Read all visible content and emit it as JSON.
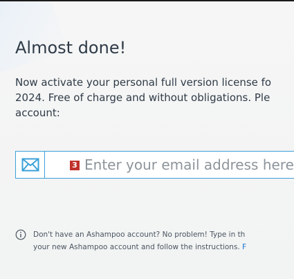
{
  "dialog": {
    "title": "Almost done!",
    "intro_lines": [
      "Now activate your personal full version license fo",
      "2024. Free of charge and without obligations. Ple",
      "account:"
    ]
  },
  "email_field": {
    "icon": "mail-icon",
    "step_badge": "3",
    "placeholder": "Enter your email address here",
    "value": ""
  },
  "hint": {
    "icon": "info-icon",
    "line1": "Don't have an Ashampoo account? No problem! Type in th",
    "line2": "your new Ashampoo account and follow the instructions.",
    "line2_link": "F"
  },
  "colors": {
    "accent": "#3aa0d8",
    "badge": "#c0312b",
    "text": "#2f3b47",
    "link": "#1a73c9"
  }
}
